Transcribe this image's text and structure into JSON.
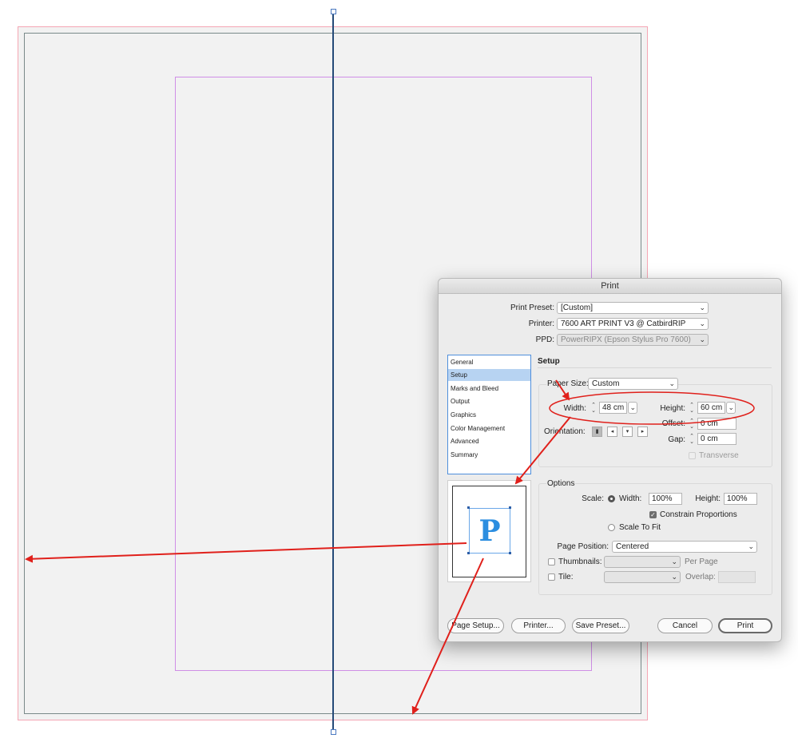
{
  "window_title": "Print",
  "print_preset": {
    "label": "Print Preset:",
    "value": "[Custom]"
  },
  "printer": {
    "label": "Printer:",
    "value": "7600 ART PRINT V3 @ CatbirdRIP"
  },
  "ppd": {
    "label": "PPD:",
    "value": "PowerRIPX (Epson Stylus Pro 7600)"
  },
  "sidebar": {
    "items": [
      {
        "label": "General",
        "selected": false
      },
      {
        "label": "Setup",
        "selected": true
      },
      {
        "label": "Marks and Bleed",
        "selected": false
      },
      {
        "label": "Output",
        "selected": false
      },
      {
        "label": "Graphics",
        "selected": false
      },
      {
        "label": "Color Management",
        "selected": false
      },
      {
        "label": "Advanced",
        "selected": false
      },
      {
        "label": "Summary",
        "selected": false
      }
    ]
  },
  "setup": {
    "section_title": "Setup",
    "paper_size": {
      "label": "Paper Size:",
      "value": "Custom"
    },
    "width": {
      "label": "Width:",
      "value": "48 cm"
    },
    "height": {
      "label": "Height:",
      "value": "60 cm"
    },
    "offset": {
      "label": "Offset:",
      "value": "0 cm"
    },
    "gap": {
      "label": "Gap:",
      "value": "0 cm"
    },
    "orientation_label": "Orientation:",
    "transverse_label": "Transverse"
  },
  "options": {
    "title": "Options",
    "scale_label": "Scale:",
    "width_label": "Width:",
    "width_value": "100%",
    "height_label": "Height:",
    "height_value": "100%",
    "constrain_label": "Constrain Proportions",
    "scale_to_fit_label": "Scale To Fit",
    "page_position_label": "Page Position:",
    "page_position_value": "Centered",
    "thumbnails_label": "Thumbnails:",
    "per_page_label": "Per Page",
    "tile_label": "Tile:",
    "overlap_label": "Overlap:"
  },
  "preview": {
    "glyph": "P"
  },
  "buttons": {
    "page_setup": "Page Setup...",
    "printer": "Printer...",
    "save_preset": "Save Preset...",
    "cancel": "Cancel",
    "print": "Print"
  },
  "colors": {
    "annotation": "#e0201b",
    "selection": "#b7d3f2",
    "guide": "#254a78"
  }
}
